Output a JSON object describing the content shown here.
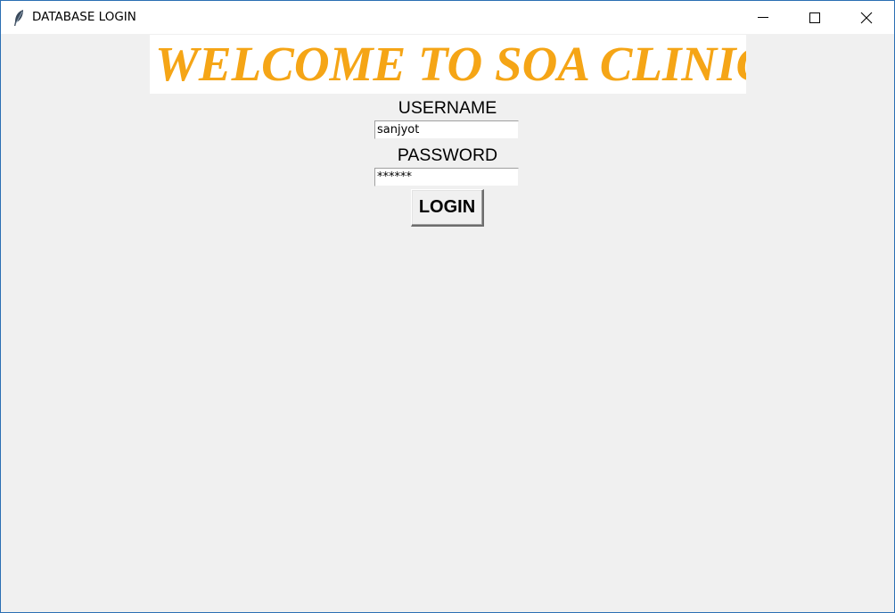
{
  "window": {
    "title": "DATABASE LOGIN",
    "app_icon": "feather-icon",
    "controls": {
      "minimize_icon": "minimize-icon",
      "maximize_icon": "maximize-icon",
      "close_icon": "close-icon"
    }
  },
  "banner": {
    "text": "WELCOME TO SOA CLINIC",
    "color": "#f5a516"
  },
  "form": {
    "username_label": "USERNAME",
    "username_value": "sanjyot",
    "password_label": "PASSWORD",
    "password_value": "******",
    "login_label": "LOGIN"
  },
  "colors": {
    "background": "#f0f0f0",
    "titlebar": "#ffffff",
    "window_border": "#2b6fb3"
  }
}
